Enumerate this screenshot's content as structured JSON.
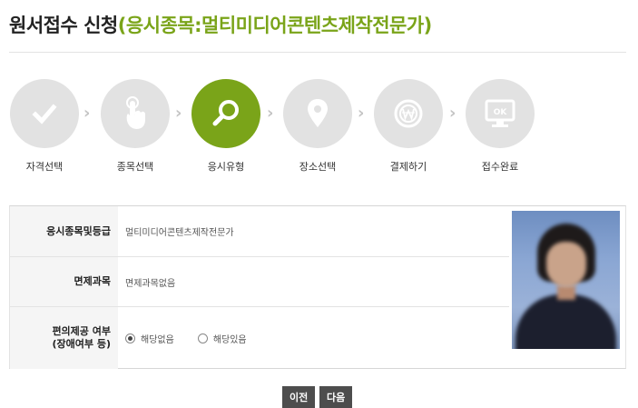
{
  "page": {
    "title_main": "원서접수 신청",
    "title_sub": "(응시종목:멀티미디어콘텐츠제작전문가)"
  },
  "steps": [
    {
      "label": "자격선택",
      "icon": "check-icon",
      "active": false
    },
    {
      "label": "종목선택",
      "icon": "hand-pointer-icon",
      "active": false
    },
    {
      "label": "응시유형",
      "icon": "search-icon",
      "active": true
    },
    {
      "label": "장소선택",
      "icon": "map-pin-icon",
      "active": false
    },
    {
      "label": "결제하기",
      "icon": "won-coin-icon",
      "active": false
    },
    {
      "label": "접수완료",
      "icon": "ok-monitor-icon",
      "active": false
    }
  ],
  "form": {
    "subject_label": "응시종목및등급",
    "subject_value": "멀티미디어콘텐츠제작전문가",
    "exempt_label": "면제과목",
    "exempt_value": "면제과목없음",
    "convenience_label_line1": "편의제공 여부",
    "convenience_label_line2": "(장애여부 등)",
    "options": [
      {
        "label": "해당없음",
        "checked": true
      },
      {
        "label": "해당있음",
        "checked": false
      }
    ]
  },
  "buttons": {
    "prev": "이전",
    "next": "다음"
  },
  "colors": {
    "accent": "#7aa419",
    "step_inactive": "#e2e2e2",
    "button": "#4d4d4d"
  }
}
